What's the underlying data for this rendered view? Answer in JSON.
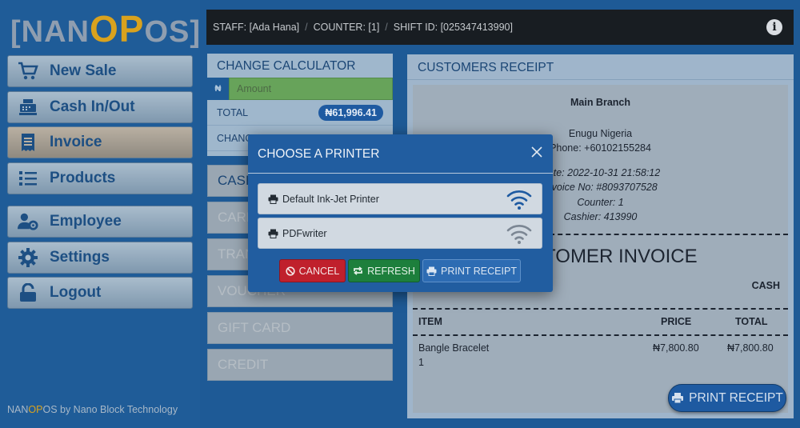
{
  "logo": {
    "pre": "[NAN",
    "o1": "O",
    "p1": "P",
    "post": "OS]"
  },
  "nav": [
    {
      "label": "New Sale",
      "icon": "cart-icon"
    },
    {
      "label": "Cash In/Out",
      "icon": "cash-register-icon"
    },
    {
      "label": "Invoice",
      "icon": "receipt-icon",
      "active": true
    },
    {
      "label": "Products",
      "icon": "list-icon"
    },
    {
      "label": "Employee",
      "icon": "user-gear-icon"
    },
    {
      "label": "Settings",
      "icon": "gear-icon"
    },
    {
      "label": "Logout",
      "icon": "unlock-icon"
    }
  ],
  "footer": {
    "nan": "NAN",
    "op": "OP",
    "rest": "OS by Nano Block Technology"
  },
  "topbar": {
    "staff": "STAFF: [Ada Hana]",
    "counter": "COUNTER: [1]",
    "shift": "SHIFT ID: [025347413990]"
  },
  "calculator": {
    "title": "CHANGE CALCULATOR",
    "currency": "₦",
    "amount_placeholder": "Amount",
    "total_label": "TOTAL",
    "total_value": "₦61,996.41",
    "change_label": "CHANG"
  },
  "payments": [
    "CASH",
    "CARD",
    "TRANSFER",
    "VOUCHER",
    "GIFT CARD",
    "CREDIT"
  ],
  "receipt": {
    "title": "CUSTOMERS RECEIPT",
    "branch": "Main Branch",
    "location": "Enugu Nigeria",
    "phone": "Phone: +60102155284",
    "date": "Date: 2022-10-31 21:58:12",
    "invoice_no": "Invoice No: #8093707528",
    "counter": "Counter: 1",
    "cashier": "Cashier: 413990",
    "heading": "CUSTOMER INVOICE",
    "payment_type": "CASH",
    "columns": {
      "item": "ITEM",
      "price": "PRICE",
      "total": "TOTAL"
    },
    "items": [
      {
        "name": "Bangle Bracelet",
        "qty": "1",
        "price": "₦7,800.80",
        "total": "₦7,800.80"
      }
    ],
    "print_label": "PRINT RECEIPT"
  },
  "modal": {
    "title": "CHOOSE A PRINTER",
    "printers": [
      {
        "name": "Default Ink-Jet Printer",
        "active": true
      },
      {
        "name": "PDFwriter",
        "active": false
      }
    ],
    "cancel": "CANCEL",
    "refresh": "REFRESH",
    "print": "PRINT RECEIPT"
  },
  "colors": {
    "accent": "#1e5aa1",
    "brand_gold": "#d9a21e",
    "cancel": "#c0202c",
    "refresh": "#1d7f3c"
  }
}
